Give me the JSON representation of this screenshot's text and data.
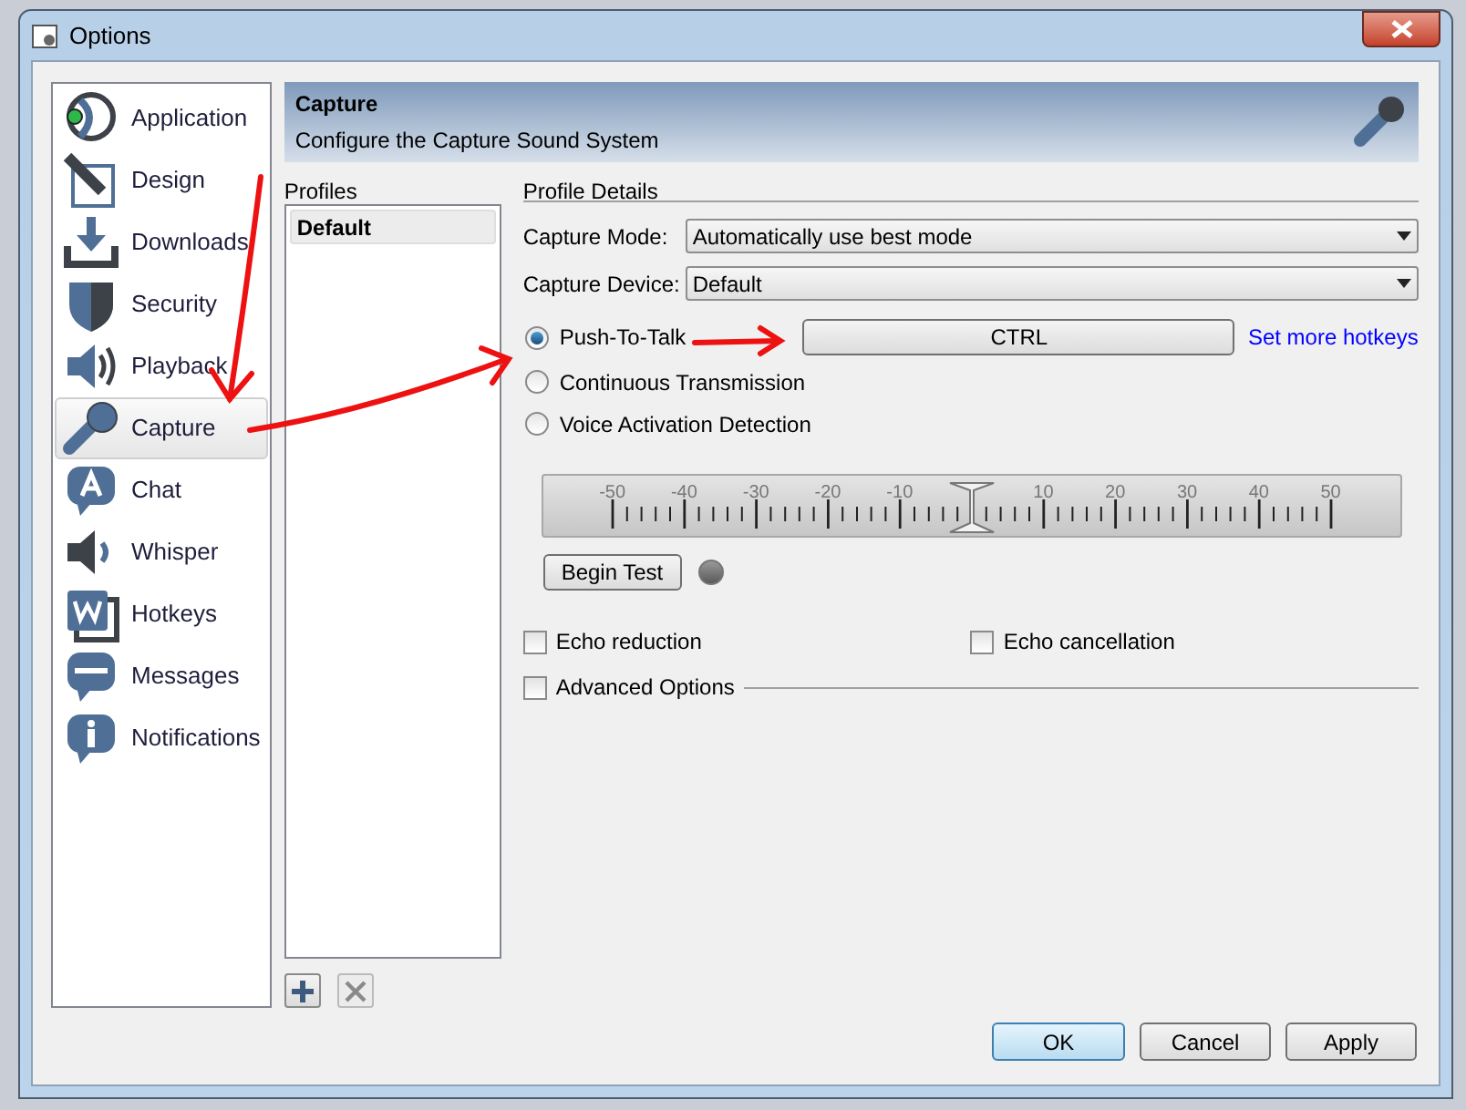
{
  "window": {
    "title": "Options"
  },
  "sidebar": {
    "items": [
      {
        "label": "Application",
        "selected": false
      },
      {
        "label": "Design",
        "selected": false
      },
      {
        "label": "Downloads",
        "selected": false
      },
      {
        "label": "Security",
        "selected": false
      },
      {
        "label": "Playback",
        "selected": false
      },
      {
        "label": "Capture",
        "selected": true
      },
      {
        "label": "Chat",
        "selected": false
      },
      {
        "label": "Whisper",
        "selected": false
      },
      {
        "label": "Hotkeys",
        "selected": false
      },
      {
        "label": "Messages",
        "selected": false
      },
      {
        "label": "Notifications",
        "selected": false
      }
    ]
  },
  "header": {
    "title": "Capture",
    "subtitle": "Configure the Capture Sound System"
  },
  "profiles": {
    "label": "Profiles",
    "items": [
      {
        "label": "Default",
        "selected": true
      }
    ]
  },
  "details": {
    "label": "Profile Details",
    "fields": [
      {
        "label": "Capture Mode:",
        "value": "Automatically use best mode"
      },
      {
        "label": "Capture Device:",
        "value": "Default"
      }
    ],
    "modes": [
      {
        "label": "Push-To-Talk",
        "selected": true
      },
      {
        "label": "Continuous Transmission",
        "selected": false
      },
      {
        "label": "Voice Activation Detection",
        "selected": false
      }
    ],
    "hotkey": "CTRL",
    "hotkey_link": "Set more hotkeys",
    "threshold": {
      "scale": [
        "-50",
        "-40",
        "-30",
        "-20",
        "-10",
        "10",
        "20",
        "30",
        "40",
        "50"
      ],
      "level": 0.5
    },
    "test_button": "Begin Test",
    "options": [
      {
        "label": "Echo reduction",
        "checked": false
      },
      {
        "label": "Echo cancellation",
        "checked": false
      }
    ],
    "advanced": {
      "label": "Advanced Options",
      "checked": false
    }
  },
  "buttons": [
    {
      "label": "OK",
      "default": true
    },
    {
      "label": "Cancel",
      "default": false
    },
    {
      "label": "Apply",
      "default": false
    }
  ]
}
